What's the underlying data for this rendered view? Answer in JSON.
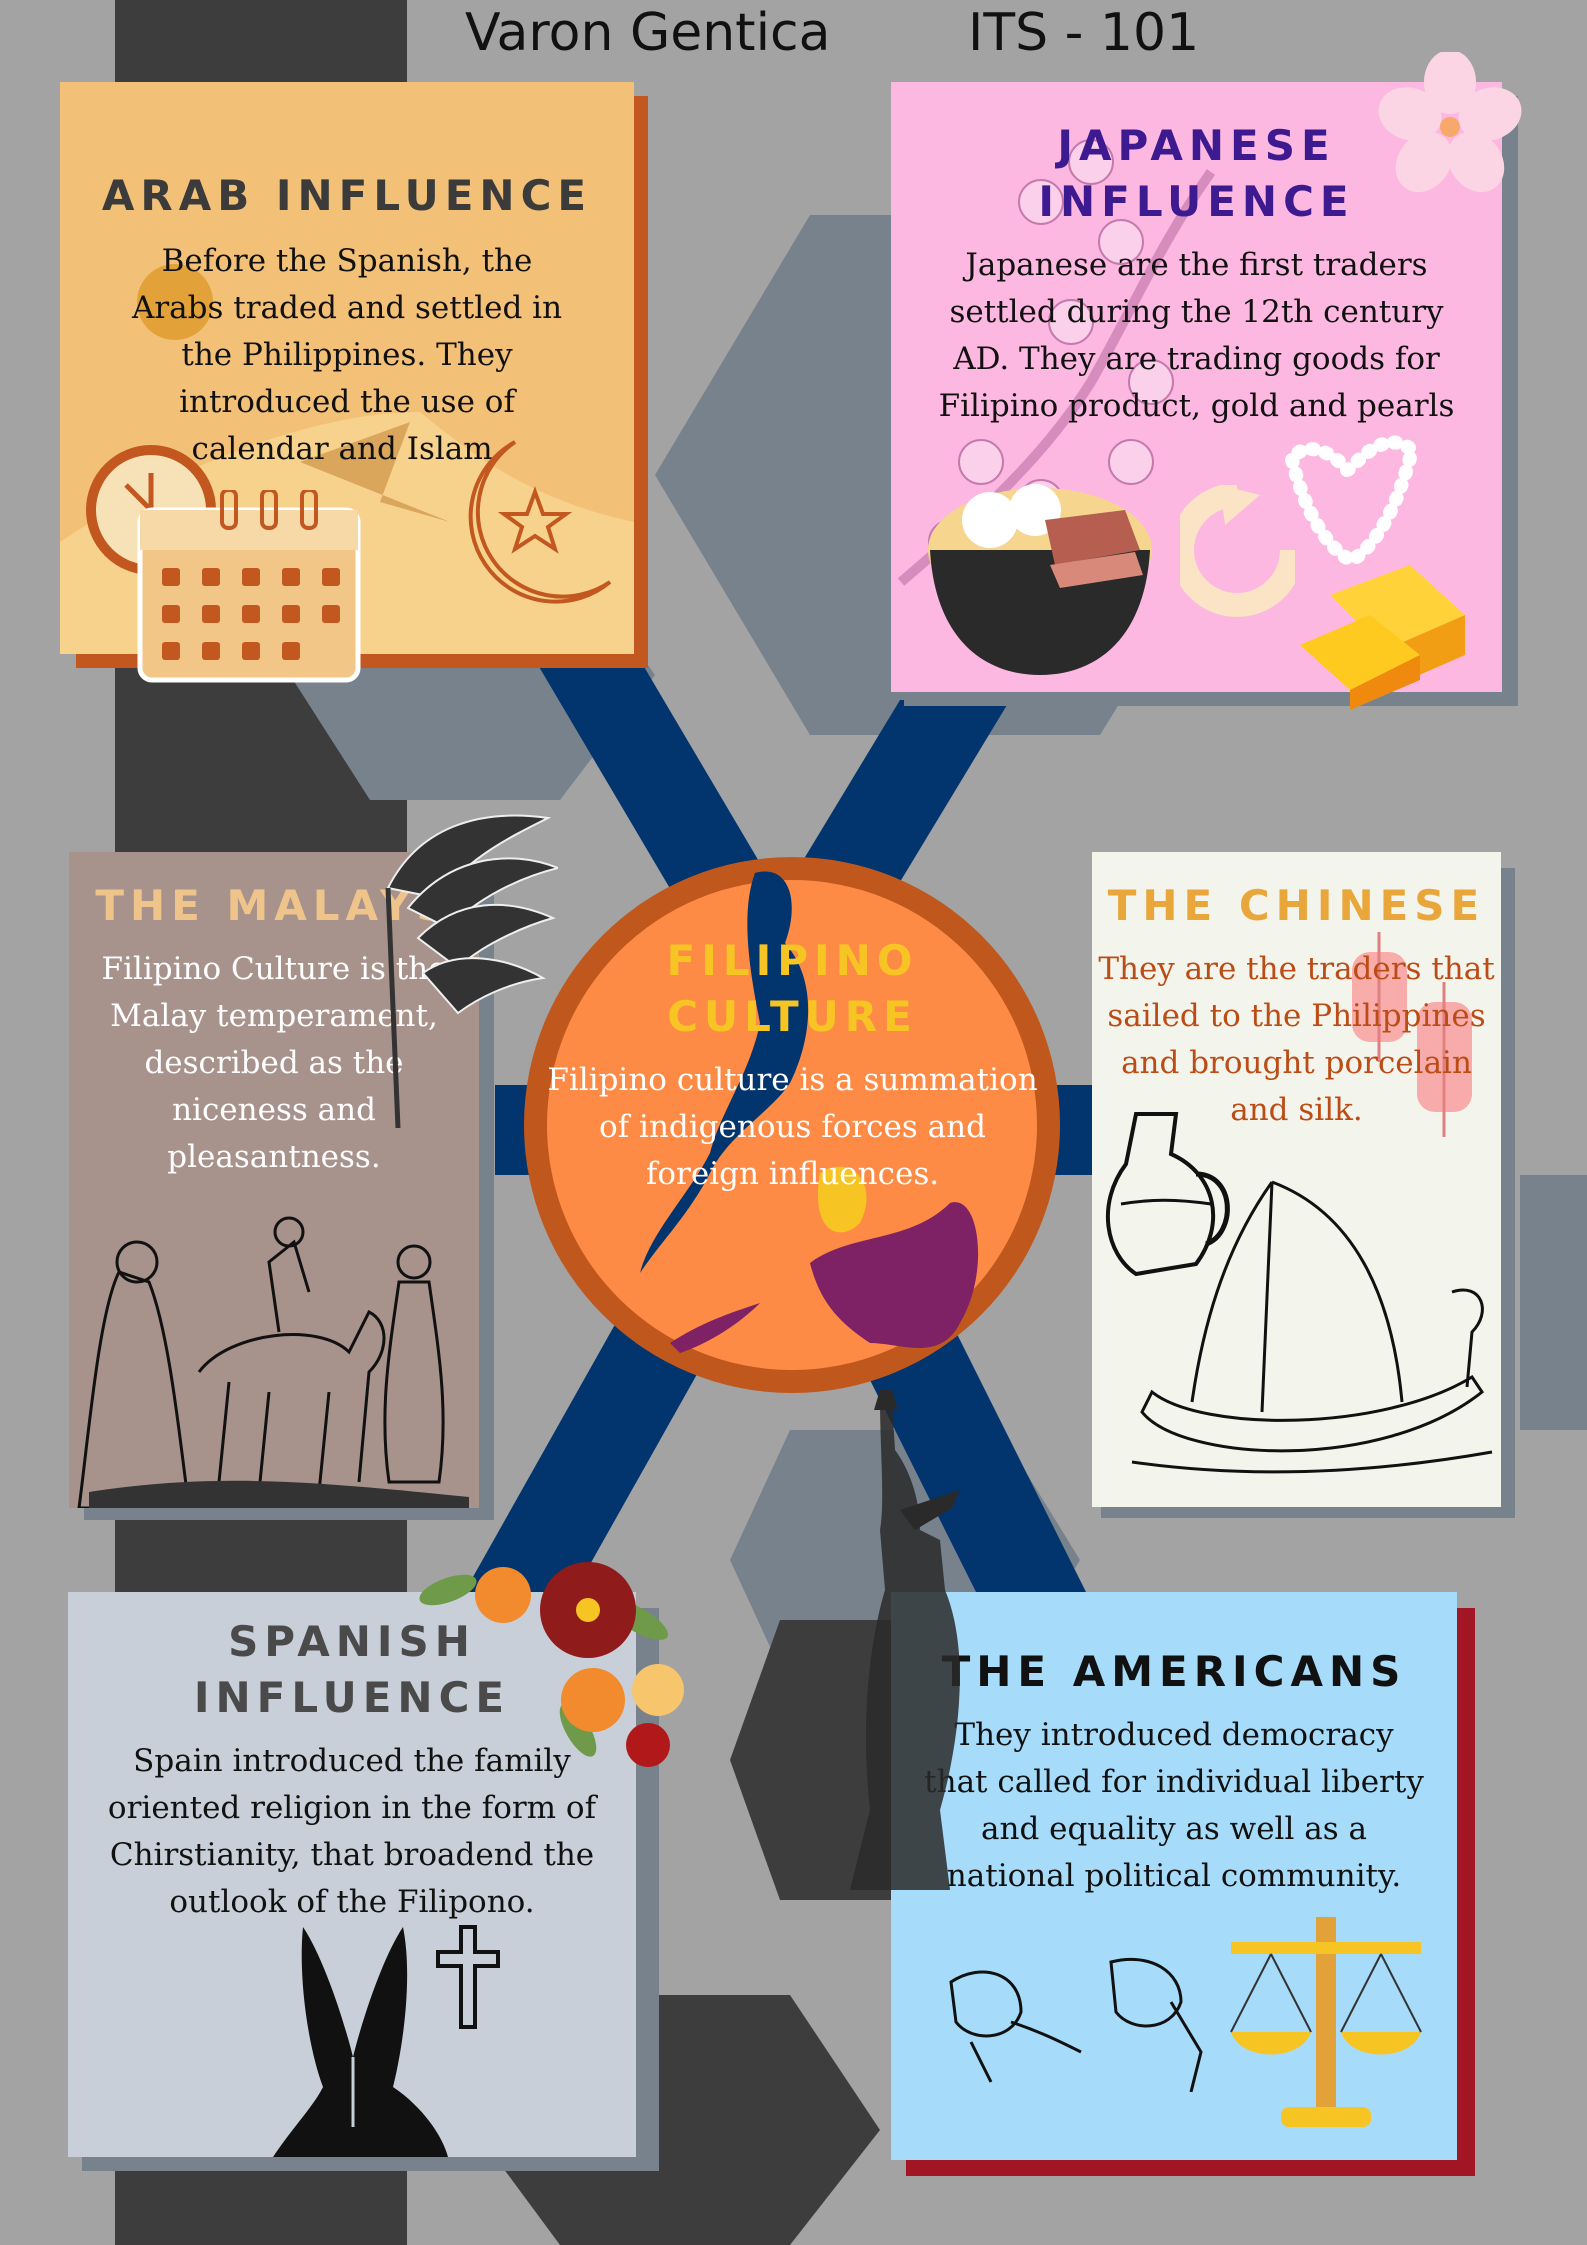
{
  "header": {
    "author": "Varon Gentica",
    "course": "ITS - 101"
  },
  "center": {
    "title": "FILIPINO CULTURE",
    "body": "Filipino culture is a summation of indigenous forces and foreign influences."
  },
  "cards": {
    "arab": {
      "title": "ARAB INFLUENCE",
      "body": "Before the Spanish, the Arabs traded and settled in the Philippines. They introduced the use of calendar and Islam."
    },
    "japanese": {
      "title": "JAPANESE INFLUENCE",
      "body": "Japanese are the first traders settled during the 12th century AD. They are trading goods for Filipino product, gold and pearls"
    },
    "malays": {
      "title": "THE MALAYS",
      "body": "Filipino Culture is the Malay temperament, described as the niceness and pleasantness."
    },
    "chinese": {
      "title": "THE CHINESE",
      "body": "They are the traders that sailed to the Philippines and brought porcelain and silk."
    },
    "spanish": {
      "title": "SPANISH INFLUENCE",
      "body": "Spain introduced the family oriented religion in the form of Chirstianity, that broadend the outlook of the Filipono."
    },
    "americans": {
      "title": "THE AMERICANS",
      "body": "They introduced democracy that called for individual liberty and equality as well as a national political community."
    }
  },
  "colors": {
    "background": "#a3a3a3",
    "arab": "#f2c077",
    "japanese": "#fdb8e2",
    "malays": "#a8928c",
    "chinese": "#f3f5ec",
    "spanish": "#c8cfd8",
    "americans": "#a6dbf9",
    "center": "#fe8b45",
    "navy": "#02346d"
  },
  "icons": [
    "clock-icon",
    "calendar-icon",
    "crescent-star-icon",
    "cherry-blossom-icon",
    "ramen-bowl-icon",
    "exchange-icon",
    "pearl-necklace-icon",
    "gold-bars-icon",
    "headdress-icon",
    "horse-rider-icon",
    "lantern-icon",
    "porcelain-jug-icon",
    "boat-icon",
    "flower-bouquet-icon",
    "praying-hands-icon",
    "cross-icon",
    "statue-of-liberty-icon",
    "broken-chains-icon",
    "scales-icon",
    "philippines-map-icon"
  ]
}
